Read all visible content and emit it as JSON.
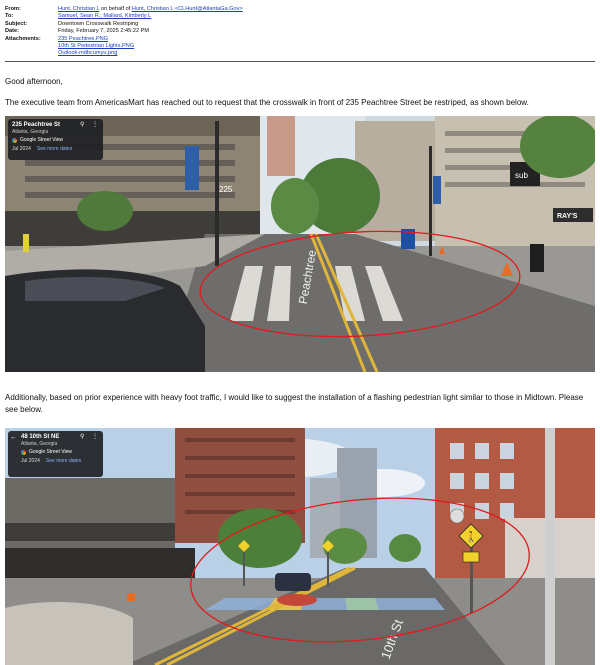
{
  "email": {
    "from_label": "From:",
    "from_name": "Hunt, Christian L",
    "from_mid": "on behalf of",
    "from_address": "Hunt, Christian L <CLHunt@AtlantaGa.Gov>",
    "to_label": "To:",
    "to_value": "Samuel, Sean R.; Mallard, Kimberly L",
    "subject_label": "Subject:",
    "subject_value": "Downtown Crosswalk Restriping",
    "date_label": "Date:",
    "date_value": "Friday, February 7, 2025 2:45:22 PM",
    "attachments_label": "Attachments:",
    "attachments": [
      "235 Peachtree.PNG",
      "10th St Pedestrian Lights.PNG",
      "Outlook-mdbcumyu.png"
    ]
  },
  "body": {
    "greeting": "Good afternoon,",
    "para1": "The executive team from AmericasMart has reached out to request that the crosswalk in front of 235 Peachtree Street be restriped, as shown below.",
    "para2": "Additionally, based on prior experience with heavy foot traffic, I would like to suggest the installation of a flashing pedestrian light similar to those in Midtown.  Please see below."
  },
  "image1": {
    "address": "235 Peachtree St",
    "city": "Atlanta, Georgia",
    "source": "Google Street View",
    "date": "Jul 2024",
    "more": "See more dates",
    "building_number": "225",
    "road_text": "Peachtree",
    "store_sign": "RAY'S",
    "shop_sign": "sub"
  },
  "image2": {
    "address": "48 10th St NE",
    "city": "Atlanta, Georgia",
    "source": "Google Street View",
    "date": "Jul 2024",
    "more": "See more dates",
    "road_text": "10th St"
  },
  "colors": {
    "link": "#1a3fb8",
    "annotation": "#e01b1b",
    "sv_card": "#202124"
  }
}
